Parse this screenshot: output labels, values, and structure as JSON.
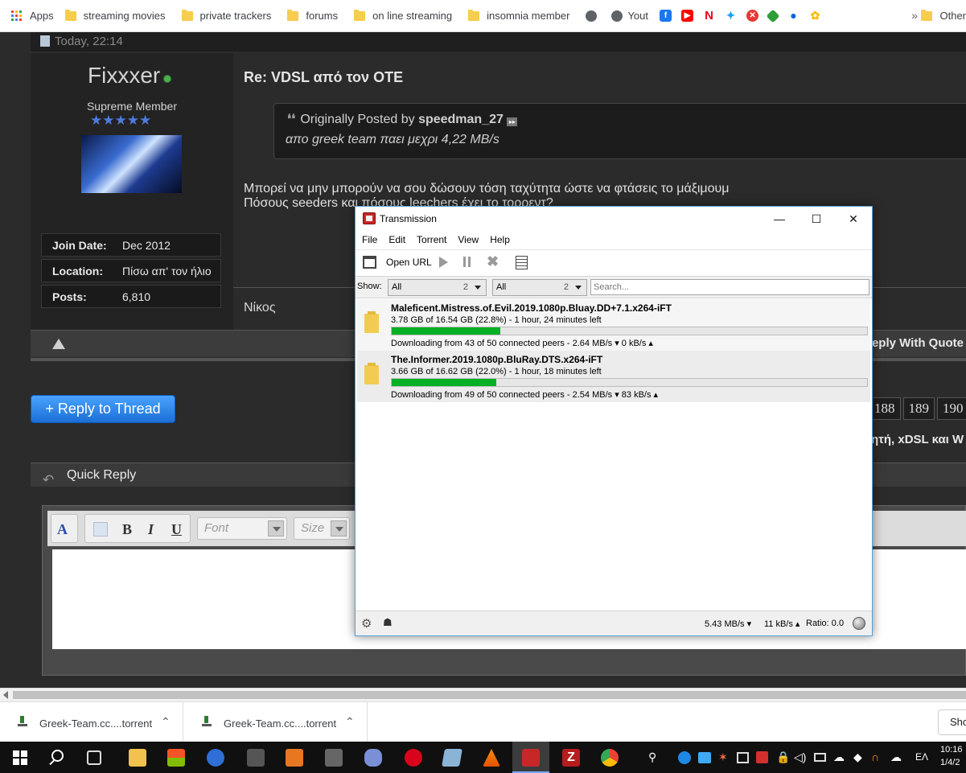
{
  "bookmarks": {
    "apps": "Apps",
    "items": [
      "streaming movies",
      "private trackers",
      "forums",
      "on line streaming",
      "insomnia member"
    ],
    "youtube_label": "Yout",
    "more": "»",
    "other": "Other"
  },
  "post": {
    "timestamp": "Today, 22:14",
    "username": "Fixxxer",
    "user_title": "Supreme Member",
    "stars": "★★★★★",
    "join_label": "Join Date:",
    "join_value": "Dec 2012",
    "location_label": "Location:",
    "location_value": "Πίσω απ' τον ήλιο",
    "posts_label": "Posts:",
    "posts_value": "6,810",
    "title": "Re: VDSL από τον OTE",
    "quote_prefix": "Originally Posted by",
    "quote_author": "speedman_27",
    "quote_text": "απο greek team παει μεχρι 4,22 MB/s",
    "body_line1": "Μπορεί να μην μπορούν να σου δώσουν τόση ταχύτητα ώστε να φτάσεις το μάξιμουμ",
    "body_line2": "Πόσους seeders και πόσους leechers έχει το τορρεντ?",
    "signature": "Νίκος",
    "reply_with_quote": "Reply With Quote"
  },
  "thread": {
    "reply_button": "+ Reply to Thread",
    "pages": [
      "188",
      "189",
      "190",
      "1"
    ],
    "breadcrumb_tail": "ητή, xDSL και W",
    "quick_reply": "Quick Reply"
  },
  "editor": {
    "font_placeholder": "Font",
    "size_placeholder": "Size"
  },
  "downloads": {
    "items": [
      {
        "name": "Greek-Team.cc....torrent"
      },
      {
        "name": "Greek-Team.cc....torrent"
      }
    ],
    "show_all": "Sho"
  },
  "taskbar": {
    "lang": "EΛ",
    "time": "10:16",
    "date": "1/4/2"
  },
  "transmission": {
    "title": "Transmission",
    "menu": [
      "File",
      "Edit",
      "Torrent",
      "View",
      "Help"
    ],
    "open_url": "Open URL",
    "show_label": "Show:",
    "filter1": {
      "value": "All",
      "count": "2"
    },
    "filter2": {
      "value": "All",
      "count": "2"
    },
    "search_placeholder": "Search...",
    "torrents": [
      {
        "name": "Maleficent.Mistress.of.Evil.2019.1080p.Bluay.DD+7.1.x264-iFT",
        "progress_text": "3.78 GB of 16.54 GB (22.8%) - 1 hour, 24 minutes left",
        "progress": 22.8,
        "status": "Downloading from 43 of 50 connected peers - 2.64 MB/s ▾   0 kB/s ▴"
      },
      {
        "name": "The.Informer.2019.1080p.BluRay.DTS.x264-iFT",
        "progress_text": "3.66 GB of 16.62 GB (22.0%) - 1 hour, 18 minutes left",
        "progress": 22.0,
        "status": "Downloading from 49 of 50 connected peers - 2.54 MB/s ▾   83 kB/s ▴"
      }
    ],
    "total_down": "5.43 MB/s ▾",
    "total_up": "11 kB/s ▴",
    "ratio": "Ratio: 0.0"
  },
  "colors": {
    "progress_green": "#06b025",
    "reply_blue": "#1b6fd6",
    "forum_bg": "#2b2b2b"
  }
}
